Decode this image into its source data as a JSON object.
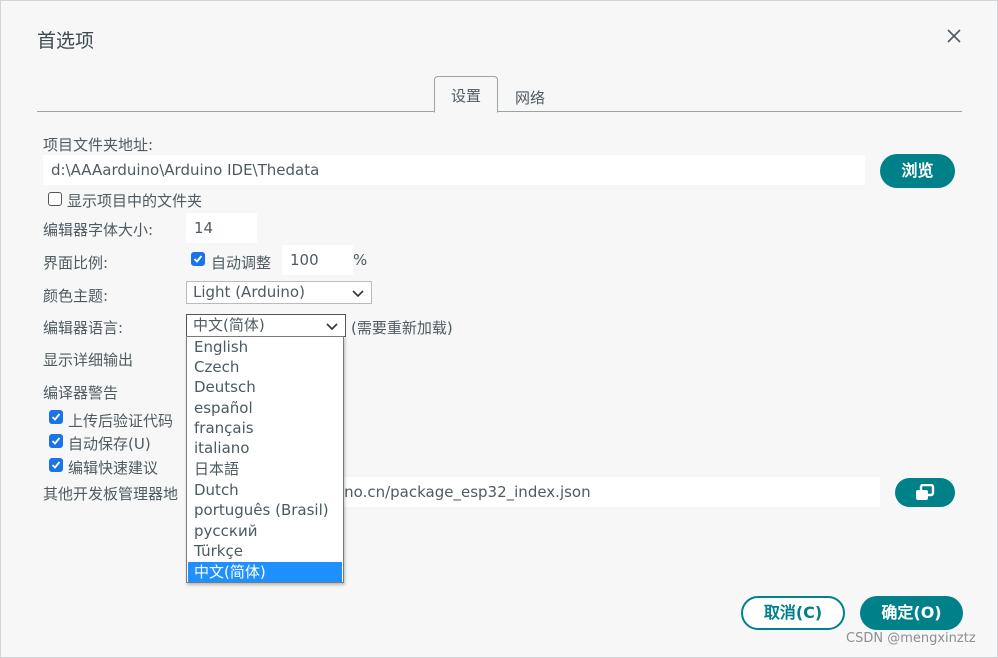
{
  "dialog": {
    "title": "首选项",
    "close_icon": "close-icon"
  },
  "tabs": [
    {
      "label": "设置",
      "active": true
    },
    {
      "label": "网络",
      "active": false
    }
  ],
  "sketchbook": {
    "label": "项目文件夹地址:",
    "path": "d:\\AAAarduino\\Arduino IDE\\Thedata",
    "browse_label": "浏览"
  },
  "show_files": {
    "label": "显示项目中的文件夹",
    "checked": false
  },
  "font_size": {
    "label": "编辑器字体大小:",
    "value": "14"
  },
  "scale": {
    "label": "界面比例:",
    "auto_label": "自动调整",
    "auto_checked": true,
    "value": "100",
    "unit": "%"
  },
  "theme": {
    "label": "颜色主题:",
    "value": "Light (Arduino)"
  },
  "language": {
    "label": "编辑器语言:",
    "value": "中文(简体)",
    "note": "(需要重新加载)",
    "options": [
      "English",
      "Czech",
      "Deutsch",
      "español",
      "français",
      "italiano",
      "日本語",
      "Dutch",
      "português (Brasil)",
      "русский",
      "Türkçe",
      "中文(简体)"
    ],
    "selected_index": 11
  },
  "verbose": {
    "label": "显示详细输出"
  },
  "warnings": {
    "label": "编译器警告"
  },
  "verify_upload": {
    "label": "上传后验证代码",
    "checked": true
  },
  "auto_save": {
    "label": "自动保存(U)",
    "checked": true
  },
  "quick_suggestions": {
    "label": "编辑快速建议",
    "checked": true
  },
  "board_manager": {
    "label": "其他开发板管理器地",
    "url_visible": "ino.cn/package_esp32_index.json",
    "open_icon": "open-window-icon"
  },
  "footer": {
    "cancel_label": "取消(C)",
    "ok_label": "确定(O)"
  },
  "watermark": "CSDN @mengxinztz",
  "colors": {
    "accent": "#00818a",
    "checkbox": "#1a73e8",
    "selection": "#1e90ff"
  }
}
